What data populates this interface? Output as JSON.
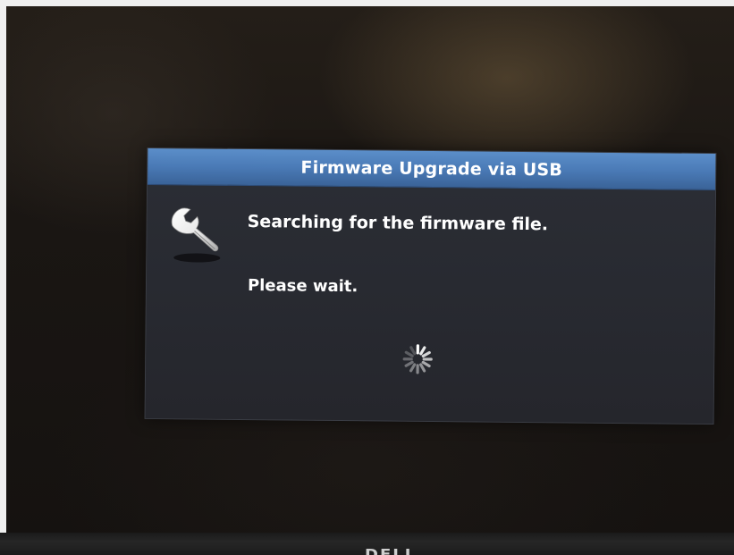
{
  "osd": {
    "title": "Firmware Upgrade via USB",
    "message": "Searching for the firmware file.",
    "status": "Please wait.",
    "icon": "wrench-icon",
    "loading_icon": "loading-spinner-icon",
    "colors": {
      "titlebar": "#4a7ab6",
      "panel": "#282a31",
      "text": "#ffffff"
    }
  },
  "bezel": {
    "brand": "DELL"
  }
}
